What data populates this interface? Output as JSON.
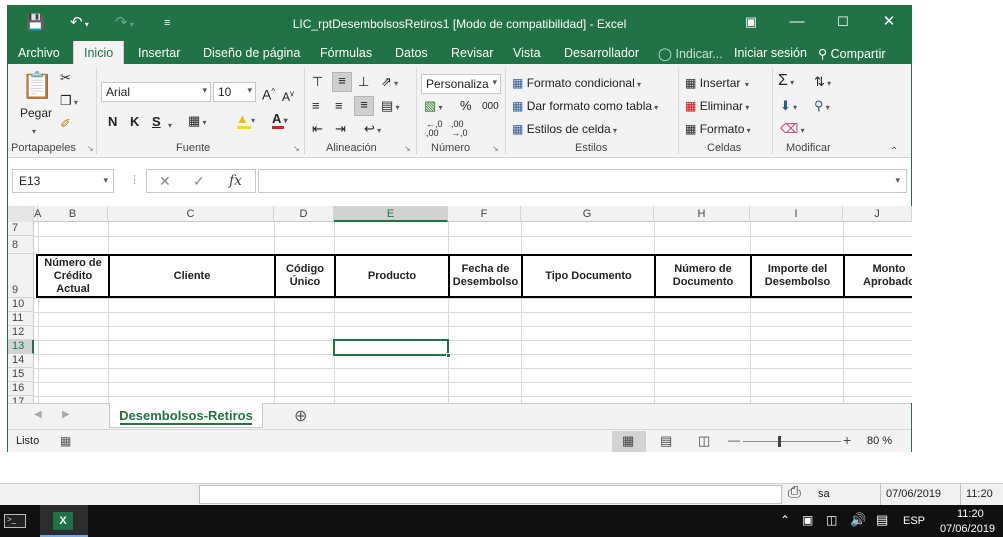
{
  "window": {
    "title": "LIC_rptDesembolsosRetiros1  [Modo de compatibilidad] - Excel"
  },
  "tabs": [
    "Archivo",
    "Inicio",
    "Insertar",
    "Diseño de página",
    "Fórmulas",
    "Datos",
    "Revisar",
    "Vista",
    "Desarrollador",
    "Indicar...",
    "Iniciar sesión",
    "Compartir"
  ],
  "ribbon": {
    "paste_label": "Pegar",
    "font_name": "Arial",
    "font_size": "10",
    "bold": "N",
    "italic": "K",
    "underline": "S",
    "number_format": "Personaliza",
    "percent": "%",
    "thousands": "000",
    "dec_inc": "←,0\n,00",
    "conditional_format": "Formato condicional",
    "format_as_table": "Dar formato como tabla",
    "cell_styles": "Estilos de celda",
    "insert": "Insertar",
    "delete": "Eliminar",
    "format": "Formato",
    "groups": [
      "Portapapeles",
      "Fuente",
      "Alineación",
      "Número",
      "Estilos",
      "Celdas",
      "Modificar"
    ]
  },
  "formula_bar": {
    "name_box": "E13",
    "fx": "fx",
    "value": ""
  },
  "grid": {
    "columns": [
      "A",
      "B",
      "C",
      "D",
      "E",
      "F",
      "G",
      "H",
      "I",
      "J"
    ],
    "rows": [
      "7",
      "8",
      "9",
      "10",
      "11",
      "12",
      "13",
      "14",
      "15",
      "16",
      "17"
    ],
    "headers": [
      "Número de Crédito Actual",
      "Cliente",
      "Código Único",
      "Producto",
      "Fecha de Desembolso",
      "Tipo Documento",
      "Número de Documento",
      "Importe del Desembolso",
      "Monto Aprobado"
    ]
  },
  "sheet_tabs": [
    "Desembolsos-Retiros"
  ],
  "status": {
    "ready": "Listo",
    "zoom": "80 %"
  },
  "lower_bar": {
    "user": "sa",
    "date": "07/06/2019",
    "time": "11:20"
  },
  "taskbar": {
    "lang": "ESP",
    "time": "11:20",
    "date": "07/06/2019"
  }
}
